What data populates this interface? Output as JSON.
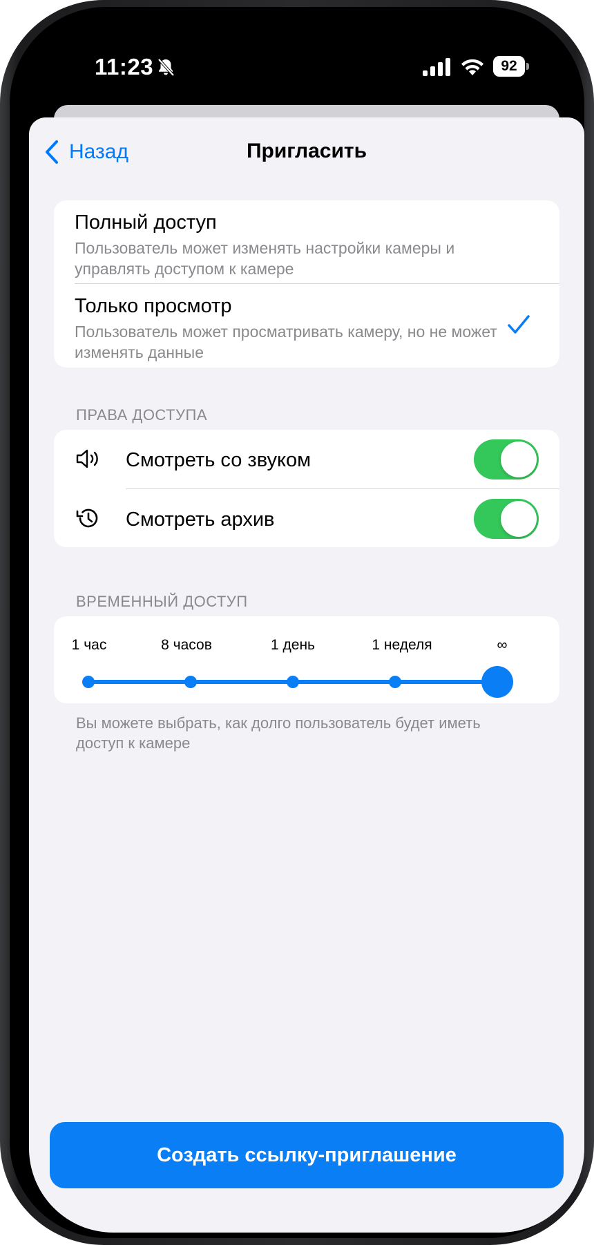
{
  "status_bar": {
    "time": "11:23",
    "battery": "92",
    "icons": [
      "bell-slash-icon",
      "cellular-signal-icon",
      "wifi-icon",
      "battery-icon"
    ]
  },
  "nav": {
    "back_label": "Назад",
    "title": "Пригласить"
  },
  "access_levels": [
    {
      "title": "Полный доступ",
      "description": "Пользователь может изменять настройки камеры и управлять доступом к камере",
      "selected": false
    },
    {
      "title": "Только просмотр",
      "description": "Пользователь может просматривать камеру, но не может изменять данные",
      "selected": true
    }
  ],
  "permissions": {
    "header": "ПРАВА ДОСТУПА",
    "items": [
      {
        "label": "Смотреть со звуком",
        "icon": "speaker-icon",
        "enabled": true
      },
      {
        "label": "Смотреть архив",
        "icon": "history-icon",
        "enabled": true
      }
    ]
  },
  "temporary_access": {
    "header": "ВРЕМЕННЫЙ ДОСТУП",
    "stops": [
      "1 час",
      "8 часов",
      "1 день",
      "1 неделя",
      "∞"
    ],
    "selected_index": 4,
    "footnote": "Вы можете выбрать, как долго пользователь будет иметь доступ к камере"
  },
  "cta": {
    "label": "Создать ссылку-приглашение"
  },
  "colors": {
    "accent": "#0A7FF5",
    "toggle_on": "#34C759",
    "background": "#F2F2F7",
    "secondary_text": "#8A8A8E"
  }
}
